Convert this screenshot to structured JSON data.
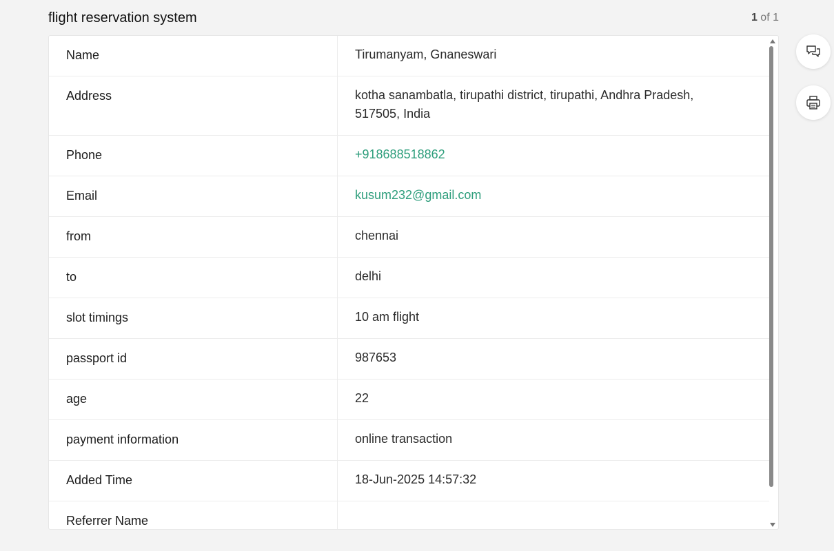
{
  "header": {
    "title": "flight reservation system",
    "pager_current": "1",
    "pager_rest": " of 1"
  },
  "record": {
    "rows": [
      {
        "label": "Name",
        "value": "Tirumanyam, Gnaneswari"
      },
      {
        "label": "Address",
        "value": "kotha sanambatla, tirupathi district, tirupathi, Andhra Pradesh, 517505, India"
      },
      {
        "label": "Phone",
        "value": "+918688518862"
      },
      {
        "label": "Email",
        "value": "kusum232@gmail.com"
      },
      {
        "label": "from",
        "value": "chennai"
      },
      {
        "label": "to",
        "value": "delhi"
      },
      {
        "label": "slot timings",
        "value": "10 am flight"
      },
      {
        "label": "passport id",
        "value": "987653"
      },
      {
        "label": "age",
        "value": "22"
      },
      {
        "label": "payment information",
        "value": "online transaction"
      },
      {
        "label": "Added Time",
        "value": "18-Jun-2025 14:57:32"
      },
      {
        "label": "Referrer Name",
        "value": ""
      }
    ]
  },
  "side_actions": {
    "comment_icon": "comment-icon",
    "print_icon": "print-icon"
  },
  "colors": {
    "link": "#2e9e7c",
    "background": "#f3f3f3"
  }
}
